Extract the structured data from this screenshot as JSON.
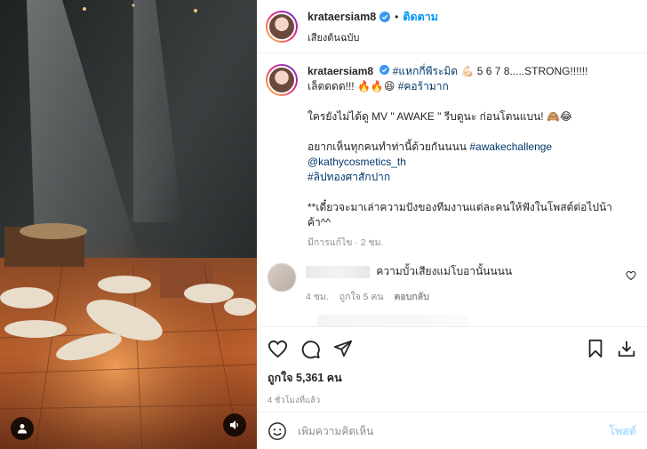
{
  "header": {
    "username": "krataersiam8",
    "separator": "•",
    "follow_label": "ติดตาม",
    "audio_label": "เสียงต้นฉบับ"
  },
  "caption": {
    "username": "krataersiam8",
    "line1_tag": "#แหกกี่พีระมิด",
    "line1_text": "5 6 7 8.....STRONG!!!!!!",
    "line2_text": "เล็ตดดด!!!",
    "line2_tag": "#คอร้ามาก",
    "line3": "ใครยังไม่ได้ดู MV \" AWAKE \" รีบดูนะ ก่อนโดนแบน!",
    "line4_text": "อยากเห็นทุกคนทำท่านี้ด้วยกันนนน",
    "line4_tag": "#awakechallenge",
    "line5_mention": "@kathycosmetics_th",
    "line6_tag": "#ลิปทองศาสักปาก",
    "line7": "**เดี๋ยวจะมาเล่าความปังของทีมงานแต่ละคนให้ฟังในโพสต์ต่อไปน้า",
    "line8": "ค้า^^",
    "meta": "มีการแก้ไข · 2 ชม."
  },
  "comment": {
    "text": "ความบั้วเสียงแม่โบอานั้นนนน",
    "time": "4 ชม.",
    "likes": "ถูกใจ 5 คน",
    "reply": "ตอบกลับ"
  },
  "actions": {
    "likes": "ถูกใจ 5,361 คน",
    "time_ago": "4 ชั่วโมงที่แล้ว"
  },
  "composer": {
    "placeholder": "เพิ่มความคิดเห็น",
    "post_label": "โพสต์"
  },
  "colors": {
    "link": "#00376b",
    "follow": "#0095f6",
    "verified": "#3897f0",
    "post_disabled": "#b2dffc"
  }
}
